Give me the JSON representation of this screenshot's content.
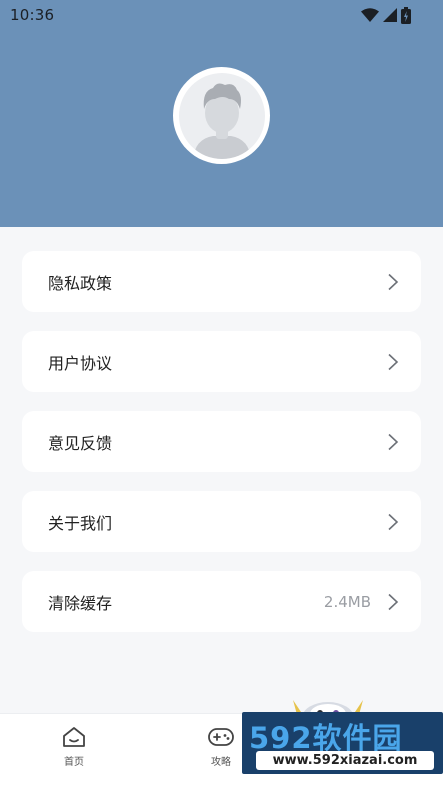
{
  "status_bar": {
    "time": "10:36"
  },
  "profile": {
    "avatar_alt": "default avatar"
  },
  "menu": {
    "items": [
      {
        "label": "隐私政策",
        "value": ""
      },
      {
        "label": "用户协议",
        "value": ""
      },
      {
        "label": "意见反馈",
        "value": ""
      },
      {
        "label": "关于我们",
        "value": ""
      },
      {
        "label": "清除缓存",
        "value": "2.4MB"
      }
    ]
  },
  "tabbar": {
    "tabs": [
      {
        "label": "首页",
        "icon": "home-icon"
      },
      {
        "label": "攻略",
        "icon": "gamepad-icon"
      }
    ]
  },
  "watermark": {
    "brand": "592软件园",
    "url": "www.592xiazai.com"
  },
  "colors": {
    "header": "#6b91b8",
    "background": "#f6f7f9",
    "card": "#ffffff",
    "watermark_bg": "#19406a",
    "watermark_text": "#4aa6ea"
  }
}
